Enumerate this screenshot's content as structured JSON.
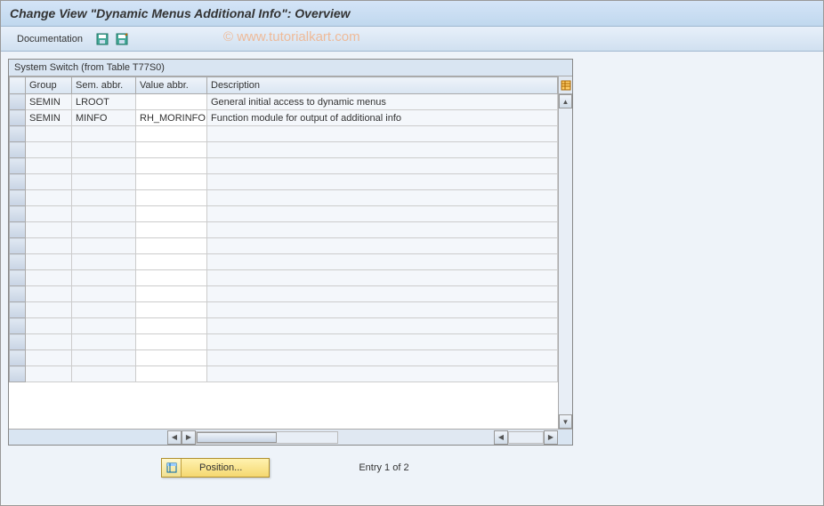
{
  "title": "Change View \"Dynamic Menus Additional Info\": Overview",
  "toolbar": {
    "documentation": "Documentation"
  },
  "watermark": "© www.tutorialkart.com",
  "panel": {
    "title": "System Switch (from Table T77S0)",
    "columns": {
      "group": "Group",
      "sem": "Sem. abbr.",
      "val": "Value abbr.",
      "desc": "Description"
    },
    "rows": [
      {
        "group": "SEMIN",
        "sem": "LROOT",
        "val": "",
        "desc": "General initial access to dynamic menus"
      },
      {
        "group": "SEMIN",
        "sem": "MINFO",
        "val": "RH_MORINFO",
        "desc": "Function module for output of additional info"
      }
    ]
  },
  "footer": {
    "position_label": "Position...",
    "entry_text": "Entry 1 of 2"
  }
}
